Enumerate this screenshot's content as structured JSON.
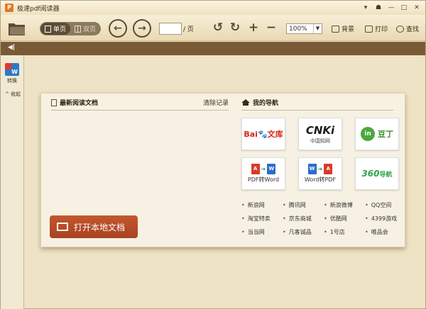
{
  "window": {
    "title": "极速pdf阅读器",
    "controls": [
      "▾",
      "☗",
      "—",
      "□",
      "✕"
    ]
  },
  "toolbar": {
    "single_page": "单页",
    "double_page": "双页",
    "page_value": "",
    "page_unit": "/ 页",
    "zoom": "100%",
    "background": "背景",
    "print": "打印",
    "find": "查找"
  },
  "sidebar": {
    "convert_label": "转换",
    "collapse_label": "^ 收起"
  },
  "recent": {
    "title": "最新阅读文档",
    "clear": "清除记录",
    "open_button": "打开本地文档"
  },
  "nav": {
    "title": "我的导航",
    "tiles": {
      "baidu_red": "Bai",
      "baidu_blue": "文库",
      "cnki_logo": "CNKi",
      "cnki_sub": "中国知网",
      "douding_mark": "in",
      "douding_text": "豆丁",
      "pdf2word_label": "PDF转Word",
      "word2pdf_label": "Word转PDF",
      "daohang_360": "360",
      "daohang_text": "导航"
    },
    "links": [
      "新浪网",
      "腾讯网",
      "新浪微博",
      "QQ空间",
      "淘宝特卖",
      "京东商城",
      "优酷网",
      "4399游戏",
      "当当网",
      "凡客诚品",
      "1号店",
      "唯品会"
    ]
  }
}
